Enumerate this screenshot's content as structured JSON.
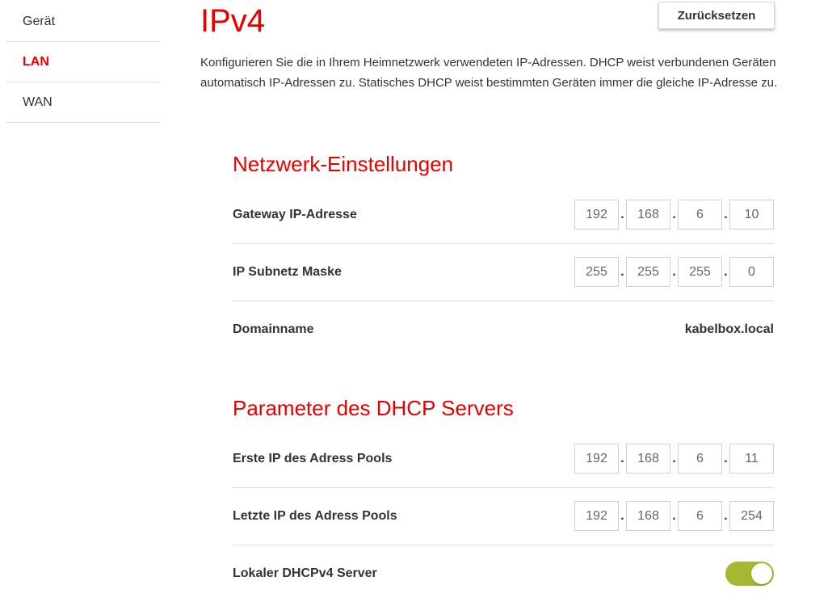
{
  "sidebar": {
    "items": [
      {
        "label": "Gerät",
        "active": false
      },
      {
        "label": "LAN",
        "active": true
      },
      {
        "label": "WAN",
        "active": false
      }
    ]
  },
  "header": {
    "title": "IPv4",
    "reset_label": "Zurücksetzen",
    "intro": "Konfigurieren Sie die in Ihrem Heimnetzwerk verwendeten IP-Adressen. DHCP weist verbundenen Geräten automatisch IP-Adressen zu. Statisches DHCP weist bestimmten Geräten immer die gleiche IP-Adresse zu."
  },
  "network": {
    "title": "Netzwerk-Einstellungen",
    "gateway": {
      "label": "Gateway IP-Adresse",
      "octets": [
        "192",
        "168",
        "6",
        "10"
      ]
    },
    "subnet": {
      "label": "IP Subnetz Maske",
      "octets": [
        "255",
        "255",
        "255",
        "0"
      ]
    },
    "domain": {
      "label": "Domainname",
      "value": "kabelbox.local"
    }
  },
  "dhcp": {
    "title": "Parameter des DHCP Servers",
    "first": {
      "label": "Erste IP des Adress Pools",
      "octets": [
        "192",
        "168",
        "6",
        "11"
      ]
    },
    "last": {
      "label": "Letzte IP des Adress Pools",
      "octets": [
        "192",
        "168",
        "6",
        "254"
      ]
    },
    "local_server": {
      "label": "Lokaler DHCPv4 Server",
      "enabled": true
    }
  },
  "colors": {
    "accent": "#e60000",
    "toggle_on": "#a6b832"
  }
}
